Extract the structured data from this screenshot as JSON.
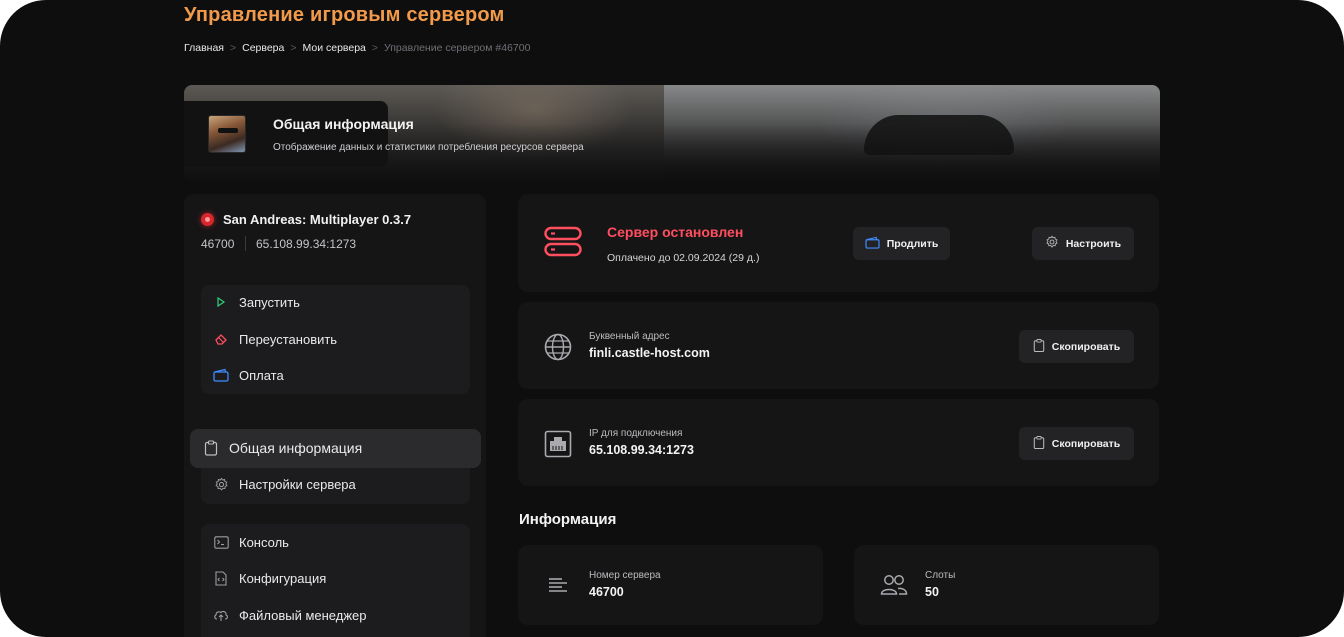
{
  "header": {
    "title": "Управление игровым сервером",
    "breadcrumb": [
      "Главная",
      "Сервера",
      "Мои сервера",
      "Управление сервером #46700"
    ],
    "breadcrumb_separator": ">"
  },
  "banner": {
    "title": "Общая информация",
    "subtitle": "Отображение данных и статистики потребления ресурсов сервера"
  },
  "server": {
    "name": "San Andreas: Multiplayer 0.3.7",
    "id": "46700",
    "address": "65.108.99.34:1273",
    "status_color": "#d6272d"
  },
  "sidebar": {
    "actions": [
      {
        "label": "Запустить",
        "icon": "play-icon"
      },
      {
        "label": "Переустановить",
        "icon": "eraser-icon"
      },
      {
        "label": "Оплата",
        "icon": "wallet-icon"
      }
    ],
    "nav": [
      {
        "label": "Общая информация",
        "icon": "clipboard-icon",
        "active": true
      },
      {
        "label": "Настройки сервера",
        "icon": "gear-icon",
        "active": false
      }
    ],
    "tools": [
      {
        "label": "Консоль",
        "icon": "terminal-icon"
      },
      {
        "label": "Конфигурация",
        "icon": "code-file-icon"
      },
      {
        "label": "Файловый менеджер",
        "icon": "cloud-upload-icon"
      }
    ]
  },
  "status_card": {
    "title": "Сервер остановлен",
    "subtitle": "Оплачено до 02.09.2024 (29 д.)",
    "extend_label": "Продлить",
    "configure_label": "Настроить",
    "status_color": "#ff4f5e"
  },
  "domain_card": {
    "label": "Буквенный адрес",
    "value": "finli.castle-host.com",
    "copy_label": "Скопировать"
  },
  "ip_card": {
    "label": "IP для подключения",
    "value": "65.108.99.34:1273",
    "copy_label": "Скопировать"
  },
  "info": {
    "title": "Информация",
    "server_number_label": "Номер сервера",
    "server_number_value": "46700",
    "slots_label": "Слоты",
    "slots_value": "50"
  },
  "colors": {
    "accent": "#f29a4a",
    "danger": "#ff4f5e",
    "blue": "#3f8cff",
    "green": "#2fcf7a",
    "background": "#0e0e0f"
  }
}
